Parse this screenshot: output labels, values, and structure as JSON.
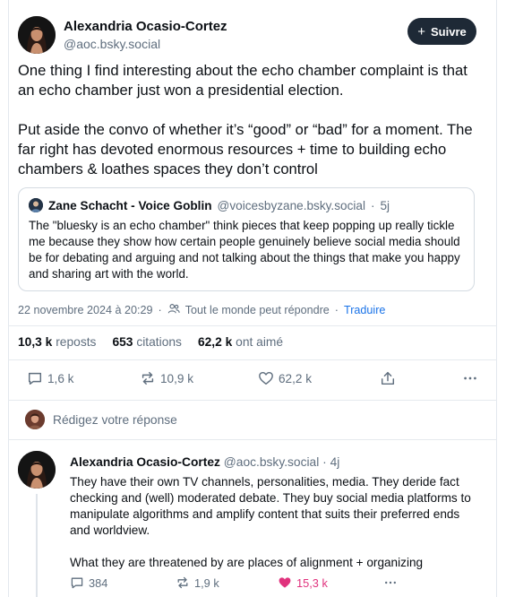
{
  "post": {
    "author_name": "Alexandria Ocasio-Cortez",
    "author_handle": "@aoc.bsky.social",
    "follow_label": "Suivre",
    "follow_plus": "+",
    "paragraphs": [
      "One thing I find interesting about the echo chamber complaint is that an echo chamber just won a presidential election.",
      "Put aside the convo of whether it’s “good” or “bad” for a moment. The far right has devoted enormous resources + time to building echo chambers & loathes spaces they don’t control"
    ],
    "quote": {
      "author_name": "Zane Schacht - Voice Goblin",
      "author_handle": "@voicesbyzane.bsky.social",
      "separator": "·",
      "age": "5j",
      "text": "The \"bluesky is an echo chamber\" think pieces that keep popping up really tickle me because they show how certain people genuinely believe social media should be for debating and arguing and not talking about the things that make you happy and sharing art with the world."
    },
    "meta": {
      "date": "22 novembre 2024 à 20:29",
      "separator": "·",
      "audience": "Tout le monde peut répondre",
      "translate": "Traduire"
    },
    "stats": {
      "reposts_count": "10,3 k",
      "reposts_label": "reposts",
      "citations_count": "653",
      "citations_label": "citations",
      "likes_count": "62,2 k",
      "likes_label": "ont aimé"
    },
    "actions": {
      "replies": "1,6 k",
      "reposts": "10,9 k",
      "likes": "62,2 k"
    }
  },
  "reply_box": {
    "placeholder": "Rédigez votre réponse"
  },
  "reply": {
    "author_name": "Alexandria Ocasio-Cortez",
    "author_handle": "@aoc.bsky.social",
    "separator": "·",
    "age": "4j",
    "paragraphs": [
      "They have their own TV channels, personalities, media. They deride fact checking and (well) moderated debate. They buy social media platforms to manipulate algorithms and amplify content that suits their preferred ends and worldview.",
      "What they are threatened by are places of alignment + organizing"
    ],
    "actions": {
      "replies": "384",
      "reposts": "1,9 k",
      "likes": "15,3 k"
    }
  },
  "colors": {
    "accent": "#1a73e8",
    "like_active": "#e0327d",
    "follow_bg": "#1e2936",
    "muted_text": "#5f6e7e"
  },
  "icons": [
    "plus-icon",
    "people-icon",
    "reply-icon",
    "repost-icon",
    "heart-icon",
    "share-icon",
    "more-icon"
  ]
}
